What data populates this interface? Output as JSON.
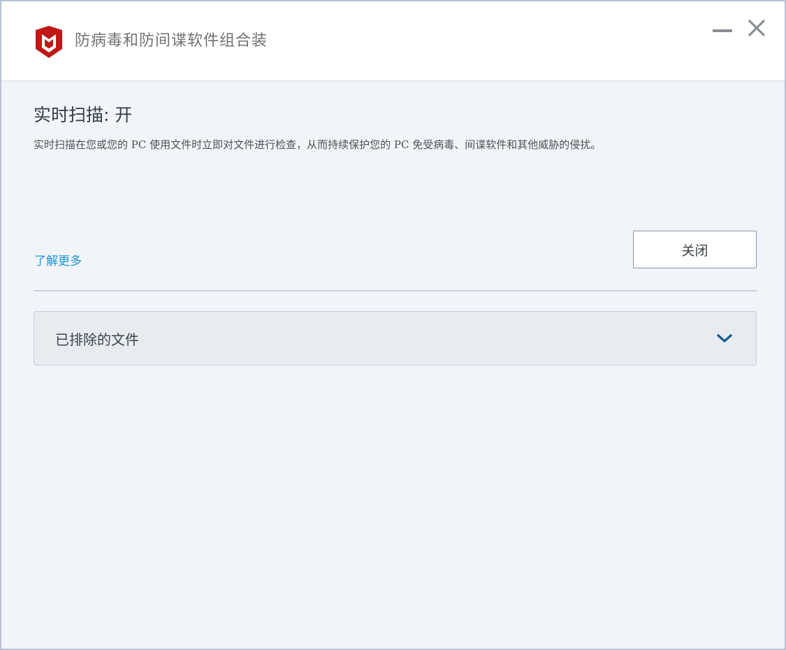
{
  "window": {
    "title": "防病毒和防间谍软件组合装",
    "logo_icon": "mcafee-shield-logo",
    "minimize_icon": "minimize-icon",
    "close_icon": "close-icon"
  },
  "scan": {
    "heading": "实时扫描: 开",
    "description": "实时扫描在您或您的 PC 使用文件时立即对文件进行检查，从而持续保护您的 PC 免受病毒、间谍软件和其他威胁的侵扰。"
  },
  "actions": {
    "learn_more": "了解更多",
    "close_button": "关闭"
  },
  "excluded_files": {
    "label": "已排除的文件",
    "expanded": false,
    "chevron_icon": "chevron-down-icon"
  },
  "colors": {
    "brand_red": "#c01818",
    "link_blue": "#1e94d4",
    "chevron_blue": "#1a5e98",
    "background": "#f1f5f9"
  }
}
